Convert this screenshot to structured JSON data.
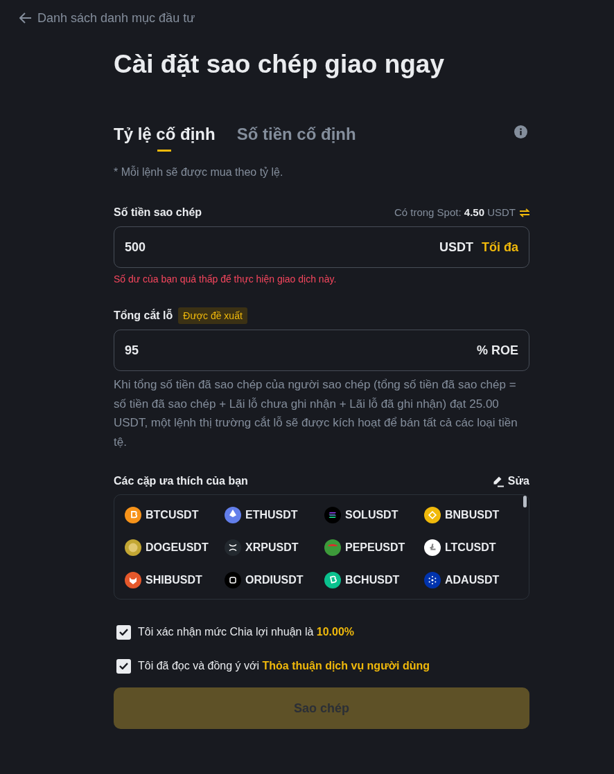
{
  "back_link": {
    "label": "Danh sách danh mục đầu tư"
  },
  "title": "Cài đặt sao chép giao ngay",
  "tabs": [
    {
      "label": "Tỷ lệ cố định",
      "selected": true
    },
    {
      "label": "Số tiền cố định",
      "selected": false
    }
  ],
  "note": "* Mỗi lệnh sẽ được mua theo tỷ lệ.",
  "copy_amount": {
    "label": "Số tiền sao chép",
    "available": "Có trong Spot: **4.50** USDT",
    "value": "500",
    "unit": "USDT",
    "max_button": "Tối đa",
    "error": "Số dư của bạn quá thấp để thực hiện giao dịch này."
  },
  "stop_loss": {
    "label": "Tổng cắt lỗ",
    "tag": "Được đề xuất",
    "value": "95",
    "unit": "% ROE",
    "description": "Khi tổng số tiền đã sao chép của người sao chép (tổng số tiền đã sao chép = số tiền đã sao chép + Lãi lỗ chưa ghi nhận + Lãi lỗ đã ghi nhận) đạt 25.00 USDT, một lệnh thị trường cắt lỗ sẽ được kích hoạt để bán tất cả các loại tiền tệ."
  },
  "favorite_pairs": {
    "label": "Các cặp ưa thích của bạn",
    "edit_button": "Sửa",
    "pairs": [
      {
        "symbol": "BTCUSDT",
        "color": "#f7931a"
      },
      {
        "symbol": "ETHUSDT",
        "color": "#627eea"
      },
      {
        "symbol": "SOLUSDT",
        "color": "#000000"
      },
      {
        "symbol": "BNBUSDT",
        "color": "#f0b90b"
      },
      {
        "symbol": "DOGEUSDT",
        "color": "#c2a633"
      },
      {
        "symbol": "XRPUSDT",
        "color": "#23292f"
      },
      {
        "symbol": "PEPEUSDT",
        "color": "#3d9a3a"
      },
      {
        "symbol": "LTCUSDT",
        "color": "#ffffff"
      },
      {
        "symbol": "SHIBUSDT",
        "color": "#e5582b"
      },
      {
        "symbol": "ORDIUSDT",
        "color": "#000000"
      },
      {
        "symbol": "BCHUSDT",
        "color": "#0ac18e"
      },
      {
        "symbol": "ADAUSDT",
        "color": "#0033ad"
      }
    ]
  },
  "agreements": [
    {
      "text": "Tôi xác nhận mức Chia lợi nhuận là **10.00%**",
      "checked": true
    },
    {
      "text": "Tôi đã đọc và đồng ý với",
      "link": "Thỏa thuận dịch vụ người dùng",
      "checked": true
    }
  ],
  "copy_button": {
    "label": "Sao chép",
    "disabled": true
  }
}
